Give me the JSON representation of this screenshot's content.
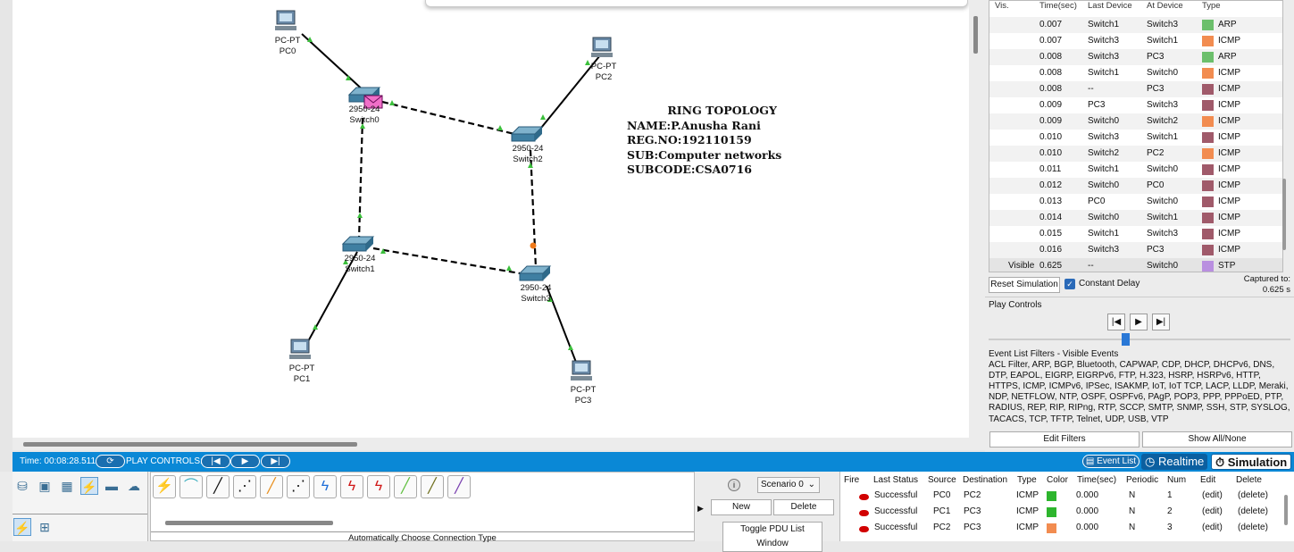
{
  "workspace": {
    "title_lines": [
      "RING TOPOLOGY",
      "NAME:P.Anusha Rani",
      "REG.NO:192110159",
      "SUB:Computer networks",
      "SUBCODE:CSA0716"
    ],
    "devices": [
      {
        "type": "PC-PT",
        "name": "PC0"
      },
      {
        "type": "PC-PT",
        "name": "PC2"
      },
      {
        "type": "2950-24",
        "name": "Switch0"
      },
      {
        "type": "2950-24",
        "name": "Switch2"
      },
      {
        "type": "2950-24",
        "name": "Switch1"
      },
      {
        "type": "2950-24",
        "name": "Switch3"
      },
      {
        "type": "PC-PT",
        "name": "PC1"
      },
      {
        "type": "PC-PT",
        "name": "PC3"
      }
    ]
  },
  "event_list": {
    "headers": [
      "Vis.",
      "Time(sec)",
      "Last Device",
      "At Device",
      "Type"
    ],
    "rows": [
      {
        "vis": "",
        "time": "0.007",
        "last": "Switch1",
        "at": "Switch3",
        "color": "#6cbf6c",
        "type": "ARP"
      },
      {
        "vis": "",
        "time": "0.007",
        "last": "Switch3",
        "at": "Switch1",
        "color": "#f28c50",
        "type": "ICMP"
      },
      {
        "vis": "",
        "time": "0.008",
        "last": "Switch3",
        "at": "PC3",
        "color": "#6cbf6c",
        "type": "ARP"
      },
      {
        "vis": "",
        "time": "0.008",
        "last": "Switch1",
        "at": "Switch0",
        "color": "#f28c50",
        "type": "ICMP"
      },
      {
        "vis": "",
        "time": "0.008",
        "last": "--",
        "at": "PC3",
        "color": "#a05a6a",
        "type": "ICMP"
      },
      {
        "vis": "",
        "time": "0.009",
        "last": "PC3",
        "at": "Switch3",
        "color": "#a05a6a",
        "type": "ICMP"
      },
      {
        "vis": "",
        "time": "0.009",
        "last": "Switch0",
        "at": "Switch2",
        "color": "#f28c50",
        "type": "ICMP"
      },
      {
        "vis": "",
        "time": "0.010",
        "last": "Switch3",
        "at": "Switch1",
        "color": "#a05a6a",
        "type": "ICMP"
      },
      {
        "vis": "",
        "time": "0.010",
        "last": "Switch2",
        "at": "PC2",
        "color": "#f28c50",
        "type": "ICMP"
      },
      {
        "vis": "",
        "time": "0.011",
        "last": "Switch1",
        "at": "Switch0",
        "color": "#a05a6a",
        "type": "ICMP"
      },
      {
        "vis": "",
        "time": "0.012",
        "last": "Switch0",
        "at": "PC0",
        "color": "#a05a6a",
        "type": "ICMP"
      },
      {
        "vis": "",
        "time": "0.013",
        "last": "PC0",
        "at": "Switch0",
        "color": "#a05a6a",
        "type": "ICMP"
      },
      {
        "vis": "",
        "time": "0.014",
        "last": "Switch0",
        "at": "Switch1",
        "color": "#a05a6a",
        "type": "ICMP"
      },
      {
        "vis": "",
        "time": "0.015",
        "last": "Switch1",
        "at": "Switch3",
        "color": "#a05a6a",
        "type": "ICMP"
      },
      {
        "vis": "",
        "time": "0.016",
        "last": "Switch3",
        "at": "PC3",
        "color": "#a05a6a",
        "type": "ICMP"
      },
      {
        "vis": "Visible",
        "time": "0.625",
        "last": "--",
        "at": "Switch0",
        "color": "#b98fe0",
        "type": "STP"
      }
    ]
  },
  "sim_controls": {
    "reset_label": "Reset Simulation",
    "constant_delay_label": "Constant Delay",
    "captured_label": "Captured to:",
    "captured_value": "0.625 s",
    "play_controls_label": "Play Controls"
  },
  "filters": {
    "title": "Event List Filters - Visible Events",
    "text": "ACL Filter, ARP, BGP, Bluetooth, CAPWAP, CDP, DHCP, DHCPv6, DNS, DTP, EAPOL, EIGRP, EIGRPv6, FTP, H.323, HSRP, HSRPv6, HTTP, HTTPS, ICMP, ICMPv6, IPSec, ISAKMP, IoT, IoT TCP, LACP, LLDP, Meraki, NDP, NETFLOW, NTP, OSPF, OSPFv6, PAgP, POP3, PPP, PPPoED, PTP, RADIUS, REP, RIP, RIPng, RTP, SCCP, SMTP, SNMP, SSH, STP, SYSLOG, TACACS, TCP, TFTP, Telnet, UDP, USB, VTP",
    "edit_label": "Edit Filters",
    "show_label": "Show All/None"
  },
  "statusbar": {
    "time_label": "Time: 00:08:28.511",
    "play_label": "PLAY CONTROLS:",
    "event_list_label": "Event List",
    "realtime_label": "Realtime",
    "simulation_label": "Simulation"
  },
  "connections": {
    "auto_label": "Automatically Choose Connection Type"
  },
  "scenario": {
    "selected": "Scenario 0",
    "new_label": "New",
    "delete_label": "Delete",
    "toggle_label": "Toggle PDU List Window"
  },
  "pdu_list": {
    "headers": [
      "Fire",
      "Last Status",
      "Source",
      "Destination",
      "Type",
      "Color",
      "Time(sec)",
      "Periodic",
      "Num",
      "Edit",
      "Delete"
    ],
    "rows": [
      {
        "status": "Successful",
        "source": "PC0",
        "dest": "PC2",
        "type": "ICMP",
        "color": "#2db52d",
        "time": "0.000",
        "periodic": "N",
        "num": "1",
        "edit": "(edit)",
        "delete": "(delete)"
      },
      {
        "status": "Successful",
        "source": "PC1",
        "dest": "PC3",
        "type": "ICMP",
        "color": "#2db52d",
        "time": "0.000",
        "periodic": "N",
        "num": "2",
        "edit": "(edit)",
        "delete": "(delete)"
      },
      {
        "status": "Successful",
        "source": "PC2",
        "dest": "PC3",
        "type": "ICMP",
        "color": "#f28c50",
        "time": "0.000",
        "periodic": "N",
        "num": "3",
        "edit": "(edit)",
        "delete": "(delete)"
      }
    ]
  }
}
